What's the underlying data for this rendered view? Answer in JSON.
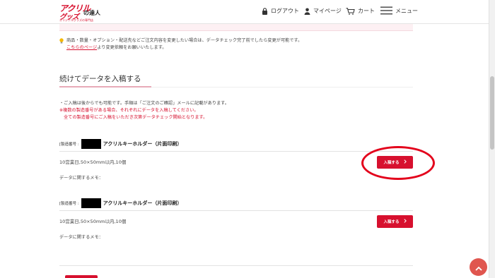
{
  "header": {
    "logo": {
      "line1": "アクリル",
      "line2": "グッズ",
      "line3": "の達人",
      "tagline": "オリジナルグッズの専門店"
    },
    "nav": {
      "logout": "ログアウト",
      "mypage": "マイページ",
      "cart": "カート",
      "menu": "メニュー"
    }
  },
  "notice": {
    "line1": "商品・数量・オプション・配送先などご注文内容を変更したい場合は、データチェック完了前でしたら変更が可能です。",
    "link_text": "こちらのページ",
    "line2_rest": "より変更依頼をお願いいたします。"
  },
  "section": {
    "title": "続けてデータを入稿する"
  },
  "info": {
    "line1": "・ご入稿は後からでも可能です。手順は「ご注文のご確認」メールに記載があります。",
    "line2": "※複数の製造番号がある場合、それぞれにデータを入稿してください。",
    "line3": "全ての製造番号にご入稿をいただき次第データチェック開始となります。"
  },
  "orders": [
    {
      "label": "[製造番号 :",
      "product": "アクリルキーホルダー（片面印刷）",
      "spec": "10営業日,50×50mm以内,10個",
      "memo": "データに関するメモ：",
      "button": "入稿する"
    },
    {
      "label": "[製造番号 :",
      "product": "アクリルキーホルダー（片面印刷）",
      "spec": "10営業日,50×50mm以内,10個",
      "memo": "データに関するメモ：",
      "button": "入稿する"
    }
  ],
  "colors": {
    "brand_red": "#d7102e",
    "annotation_red": "#e3001b",
    "to_top": "#e0564f"
  }
}
